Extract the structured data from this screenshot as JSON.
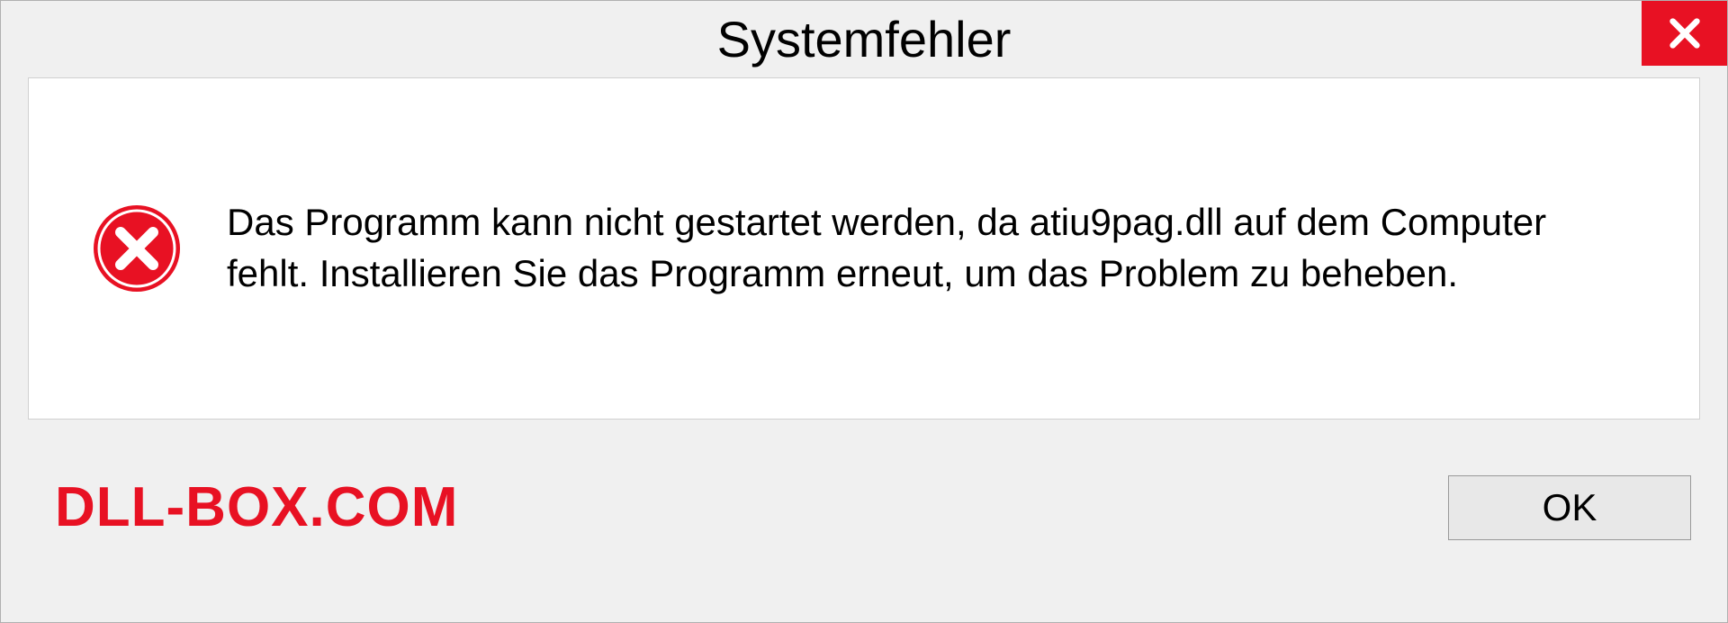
{
  "dialog": {
    "title": "Systemfehler",
    "message": "Das Programm kann nicht gestartet werden, da atiu9pag.dll auf dem Computer fehlt. Installieren Sie das Programm erneut, um das Problem zu beheben.",
    "ok_label": "OK"
  },
  "watermark": "DLL-BOX.COM",
  "colors": {
    "error_red": "#e81123",
    "background": "#f0f0f0"
  }
}
